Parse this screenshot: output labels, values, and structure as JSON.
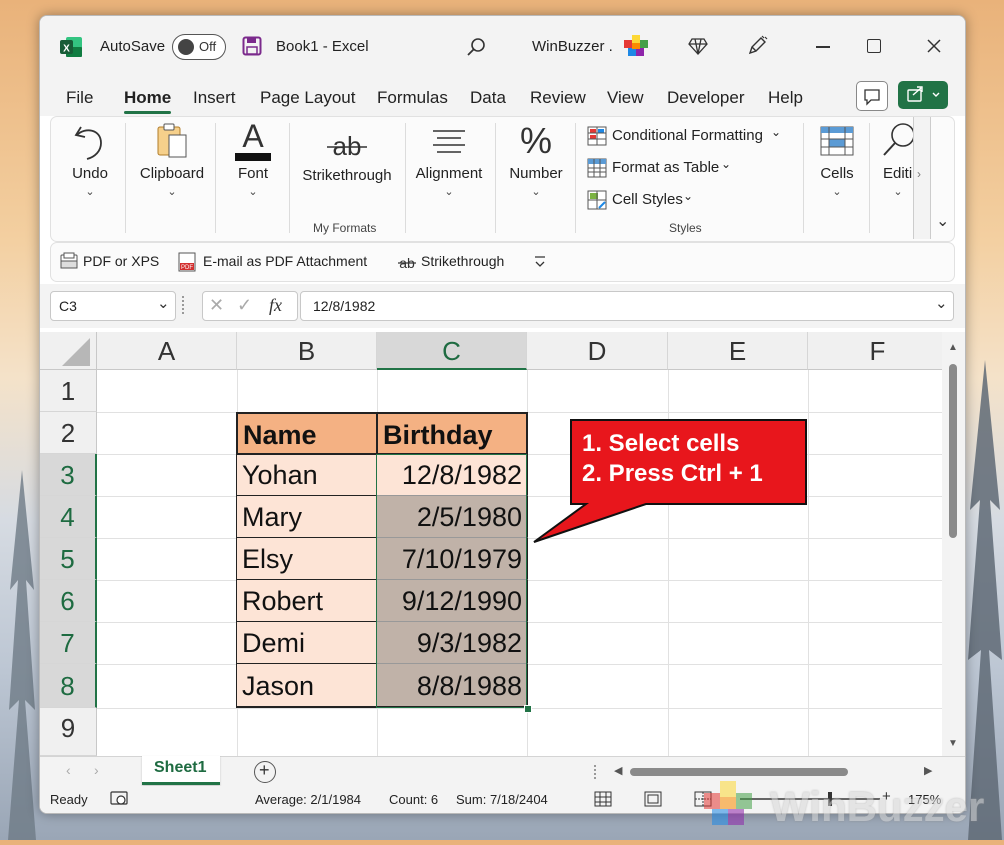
{
  "titlebar": {
    "autosave_label": "AutoSave",
    "autosave_state": "Off",
    "doc_title": "Book1  -  Excel",
    "user_name": "WinBuzzer ."
  },
  "ribbon_tabs": [
    "File",
    "Home",
    "Insert",
    "Page Layout",
    "Formulas",
    "Data",
    "Review",
    "View",
    "Developer",
    "Help"
  ],
  "ribbon": {
    "undo": "Undo",
    "clipboard": "Clipboard",
    "font": "Font",
    "strikethrough": "Strikethrough",
    "my_formats_group": "My Formats",
    "alignment": "Alignment",
    "number": "Number",
    "conditional_formatting": "Conditional Formatting",
    "format_as_table": "Format as Table",
    "cell_styles": "Cell Styles",
    "styles_group": "Styles",
    "cells": "Cells",
    "editing": "Editi"
  },
  "qat": {
    "pdf_xps": "PDF or XPS",
    "email_pdf": "E-mail as PDF Attachment",
    "strikethrough": "Strikethrough"
  },
  "formula_bar": {
    "name_box": "C3",
    "fx": "fx",
    "value": "12/8/1982"
  },
  "sheet": {
    "columns": [
      "A",
      "B",
      "C",
      "D",
      "E",
      "F"
    ],
    "rows": [
      "1",
      "2",
      "3",
      "4",
      "5",
      "6",
      "7",
      "8",
      "9"
    ],
    "header": {
      "name": "Name",
      "birthday": "Birthday"
    },
    "records": [
      {
        "name": "Yohan",
        "birthday": "12/8/1982"
      },
      {
        "name": "Mary",
        "birthday": "2/5/1980"
      },
      {
        "name": "Elsy",
        "birthday": "7/10/1979"
      },
      {
        "name": "Robert",
        "birthday": "9/12/1990"
      },
      {
        "name": "Demi",
        "birthday": "9/3/1982"
      },
      {
        "name": "Jason",
        "birthday": "8/8/1988"
      }
    ],
    "callout_line1": "1. Select cells",
    "callout_line2": "2. Press Ctrl + 1"
  },
  "sheet_tabs": {
    "active": "Sheet1"
  },
  "status": {
    "ready": "Ready",
    "average": "Average: 2/1/1984",
    "count": "Count: 6",
    "sum": "Sum: 7/18/2404",
    "zoom": "175%"
  },
  "watermark": "WinBuzzer",
  "colors": {
    "excel_green": "#217346",
    "header_fill": "#f4b183",
    "name_fill": "#fde4d6",
    "selected_fill": "#c0b2a8",
    "callout_red": "#e8161c"
  }
}
